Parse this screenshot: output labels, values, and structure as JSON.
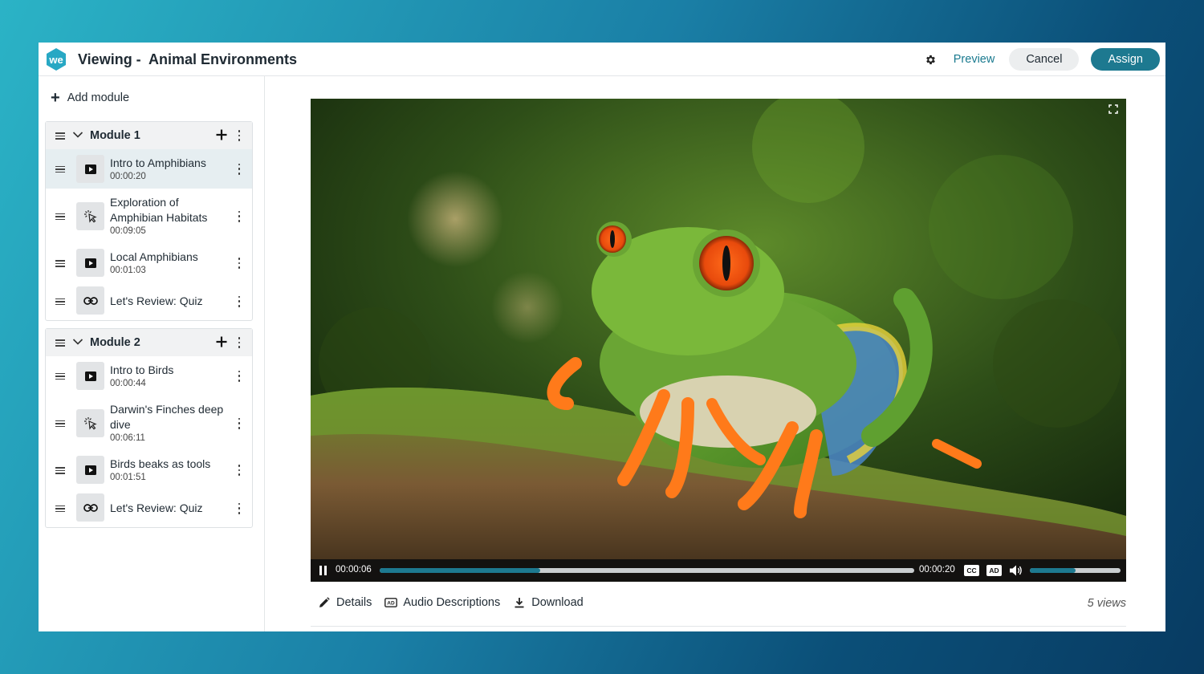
{
  "header": {
    "logo_text": "we",
    "title": "Viewing -  Animal Environments",
    "preview_label": "Preview",
    "cancel_label": "Cancel",
    "assign_label": "Assign"
  },
  "sidebar": {
    "add_module_label": "Add module",
    "modules": [
      {
        "title": "Module 1",
        "items": [
          {
            "title": "Intro to Amphibians",
            "duration": "00:00:20",
            "icon": "video-icon"
          },
          {
            "title": "Exploration of Amphibian Habitats",
            "duration": "00:09:05",
            "icon": "interactive-icon"
          },
          {
            "title": "Local Amphibians",
            "duration": "00:01:03",
            "icon": "video-icon"
          },
          {
            "title": "Let's Review: Quiz",
            "duration": "",
            "icon": "link-icon"
          }
        ]
      },
      {
        "title": "Module 2",
        "items": [
          {
            "title": "Intro to Birds",
            "duration": "00:00:44",
            "icon": "video-icon"
          },
          {
            "title": "Darwin's Finches deep dive",
            "duration": "00:06:11",
            "icon": "interactive-icon"
          },
          {
            "title": "Birds beaks as tools",
            "duration": "00:01:51",
            "icon": "video-icon"
          },
          {
            "title": "Let's Review: Quiz",
            "duration": "",
            "icon": "link-icon"
          }
        ]
      }
    ]
  },
  "player": {
    "current_time": "00:00:06",
    "total_time": "00:00:20",
    "progress_fraction": 0.3,
    "volume_fraction": 0.5,
    "cc_label": "CC",
    "ad_label": "AD"
  },
  "actions": {
    "details_label": "Details",
    "audio_label": "Audio Descriptions",
    "download_label": "Download",
    "views_label": "5 views"
  },
  "colors": {
    "accent": "#1d7990",
    "link": "#1a7a8f"
  }
}
